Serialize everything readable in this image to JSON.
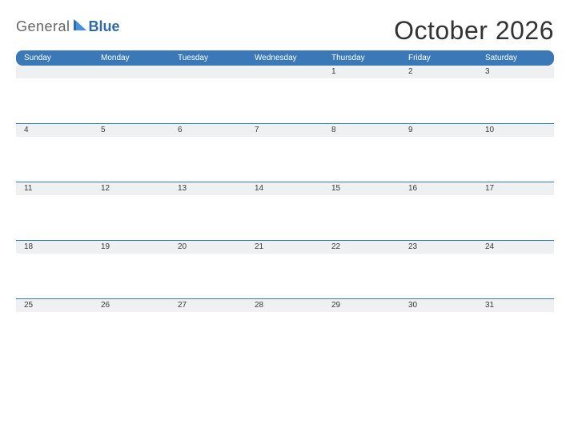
{
  "brand": {
    "word1": "General",
    "word2": "Blue"
  },
  "title": "October 2026",
  "weekdays": [
    "Sunday",
    "Monday",
    "Tuesday",
    "Wednesday",
    "Thursday",
    "Friday",
    "Saturday"
  ],
  "weeks": [
    [
      "",
      "",
      "",
      "",
      "1",
      "2",
      "3"
    ],
    [
      "4",
      "5",
      "6",
      "7",
      "8",
      "9",
      "10"
    ],
    [
      "11",
      "12",
      "13",
      "14",
      "15",
      "16",
      "17"
    ],
    [
      "18",
      "19",
      "20",
      "21",
      "22",
      "23",
      "24"
    ],
    [
      "25",
      "26",
      "27",
      "28",
      "29",
      "30",
      "31"
    ]
  ],
  "chart_data": {
    "type": "table",
    "title": "October 2026",
    "columns": [
      "Sunday",
      "Monday",
      "Tuesday",
      "Wednesday",
      "Thursday",
      "Friday",
      "Saturday"
    ],
    "rows": [
      [
        null,
        null,
        null,
        null,
        1,
        2,
        3
      ],
      [
        4,
        5,
        6,
        7,
        8,
        9,
        10
      ],
      [
        11,
        12,
        13,
        14,
        15,
        16,
        17
      ],
      [
        18,
        19,
        20,
        21,
        22,
        23,
        24
      ],
      [
        25,
        26,
        27,
        28,
        29,
        30,
        31
      ]
    ]
  }
}
